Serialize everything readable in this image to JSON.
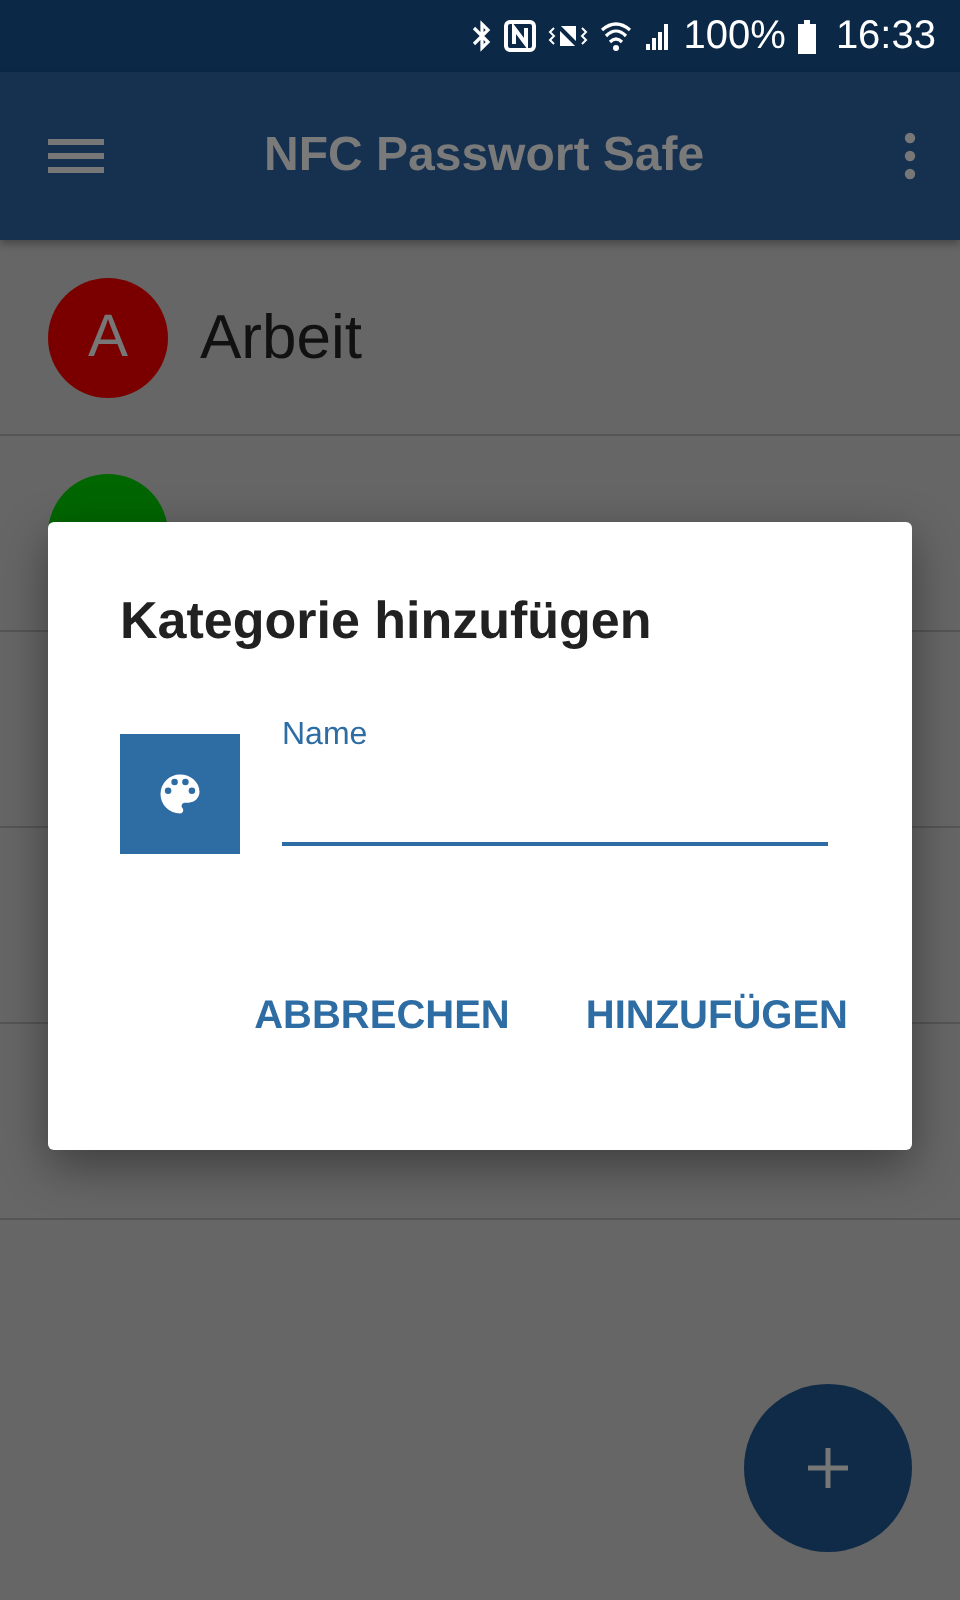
{
  "status_bar": {
    "battery_text": "100%",
    "time": "16:33"
  },
  "app_bar": {
    "title": "NFC Passwort Safe"
  },
  "categories": [
    {
      "letter": "A",
      "name": "Arbeit",
      "color": "#7a0000"
    },
    {
      "color": "#006600"
    }
  ],
  "dialog": {
    "title": "Kategorie hinzufügen",
    "field": {
      "label": "Name"
    },
    "buttons": [
      {
        "label": "ABBRECHEN"
      },
      {
        "label": "HINZUFÜGEN"
      }
    ]
  }
}
